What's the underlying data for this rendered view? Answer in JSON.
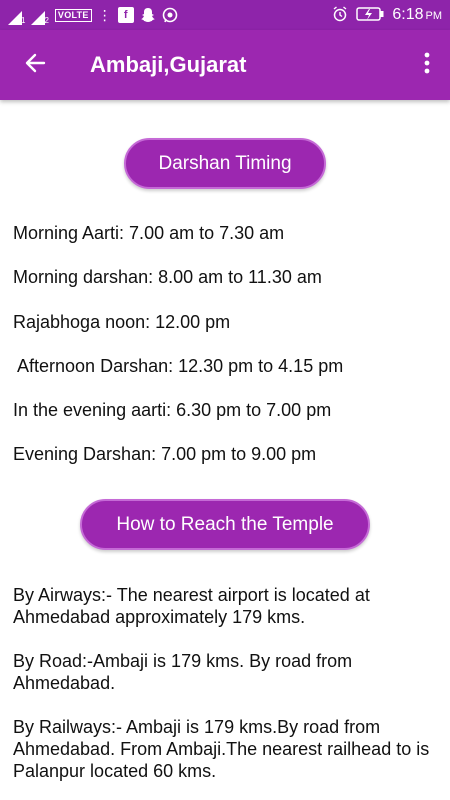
{
  "status_bar": {
    "sim1": "1",
    "sim2": "2",
    "volte": "VOLTE",
    "time": "6:18",
    "ampm": "PM",
    "icons": [
      "signal-icon",
      "signal-icon",
      "facebook-icon",
      "snapchat-icon",
      "whatsapp-icon",
      "alarm-icon",
      "battery-icon"
    ]
  },
  "app_bar": {
    "title": "Ambaji,Gujarat",
    "back_icon": "arrow-back-icon",
    "menu_icon": "more-vert-icon"
  },
  "colors": {
    "primary": "#9c27b0",
    "status": "#8e24aa"
  },
  "darshan": {
    "button_label": "Darshan Timing",
    "items": [
      "Morning Aarti: 7.00 am to 7.30 am",
      "Morning darshan: 8.00 am to 11.30 am",
      "Rajabhoga noon: 12.00 pm",
      " Afternoon Darshan: 12.30 pm to 4.15 pm",
      "In the evening aarti: 6.30 pm to 7.00 pm",
      "Evening Darshan: 7.00 pm to 9.00 pm"
    ]
  },
  "reach": {
    "button_label": "How to Reach the Temple",
    "items": [
      "By Airways:- The nearest airport is located at Ahmedabad approximately 179 kms.",
      "By Road:-Ambaji is 179 kms. By road from Ahmedabad.",
      "By Railways:- Ambaji is 179 kms.By road from Ahmedabad. From Ambaji.The nearest railhead to is Palanpur located 60 kms."
    ]
  }
}
